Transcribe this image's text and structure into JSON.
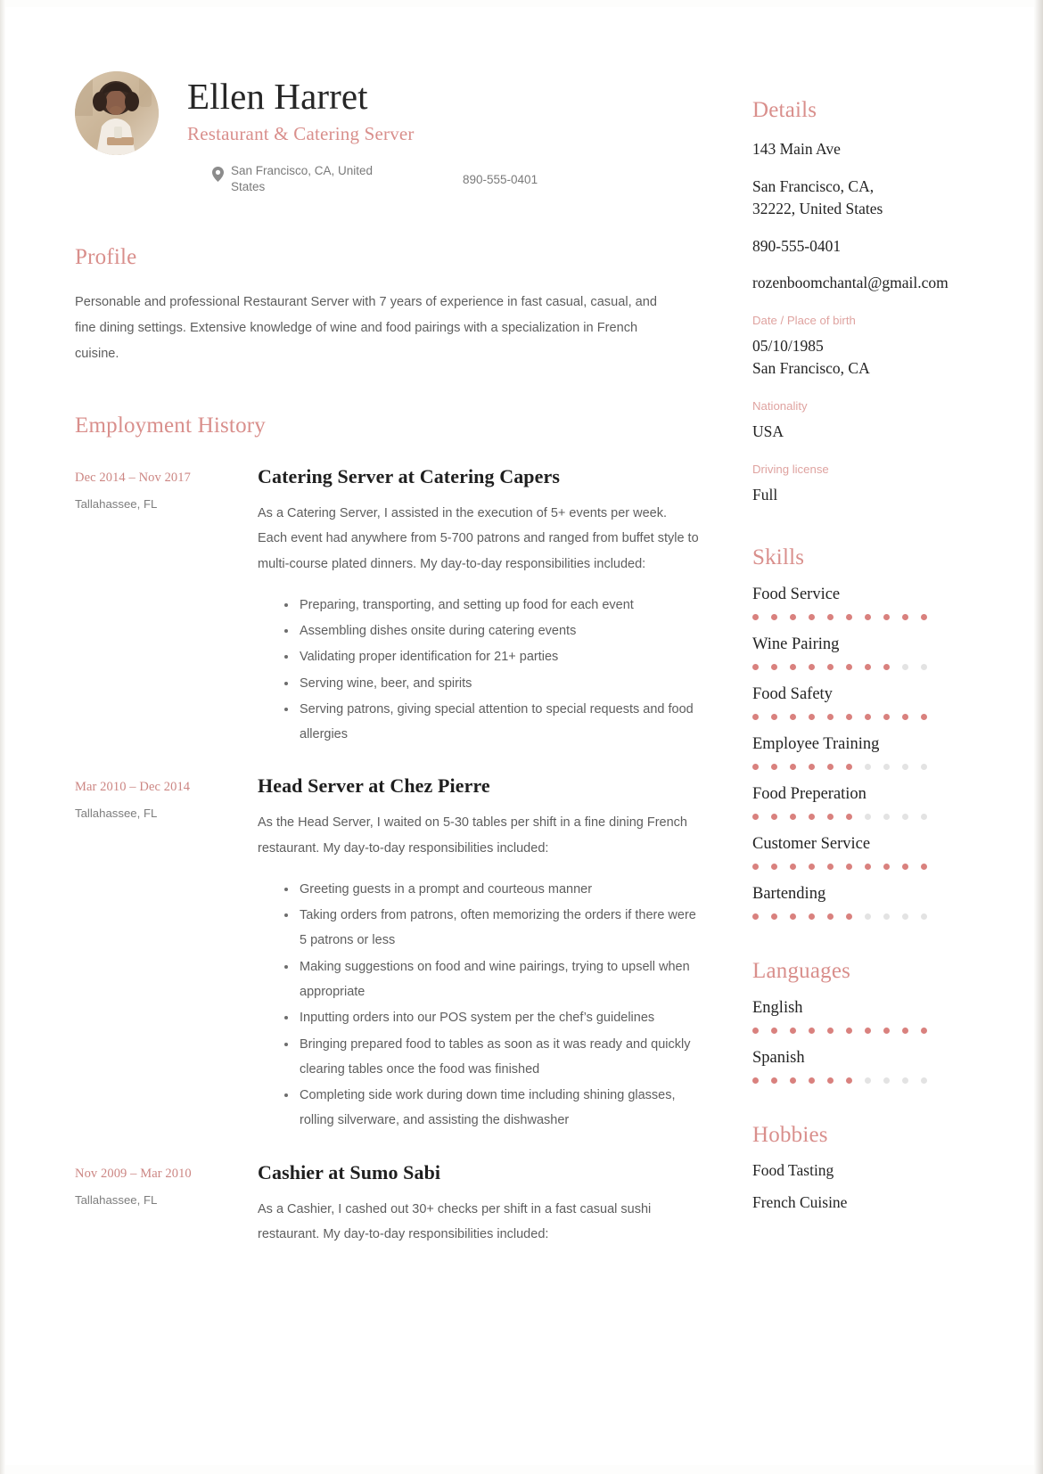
{
  "theme": {
    "accent": "#d98f8c",
    "accent_dot": "#d9817e",
    "dot_off": "#e3e3e3",
    "text": "#232323",
    "body_text": "#5e5e5e"
  },
  "header": {
    "name": "Ellen Harret",
    "job_title": "Restaurant & Catering Server",
    "location": "San Francisco, CA, United States",
    "phone": "890-555-0401"
  },
  "profile": {
    "heading": "Profile",
    "text": "Personable and professional Restaurant Server with 7 years of experience in fast casual, casual, and fine dining settings. Extensive knowledge of wine and food pairings with a specialization in French cuisine."
  },
  "employment": {
    "heading": "Employment History",
    "jobs": [
      {
        "dates": "Dec 2014 – Nov 2017",
        "location": "Tallahassee, FL",
        "title": "Catering Server at Catering Capers",
        "description": "As a Catering Server, I assisted in the execution of 5+ events per week. Each event had anywhere from 5-700 patrons and ranged from buffet style to multi-course plated dinners. My day-to-day responsibilities included:",
        "bullets": [
          "Preparing, transporting, and setting up food for each event",
          "Assembling dishes onsite during catering events",
          "Validating proper identification for 21+ parties",
          "Serving wine, beer, and spirits",
          "Serving patrons, giving special attention to special requests and food allergies"
        ]
      },
      {
        "dates": "Mar 2010 – Dec 2014",
        "location": "Tallahassee, FL",
        "title": "Head Server at Chez Pierre",
        "description": "As the Head Server, I waited on 5-30 tables per shift in a fine dining French restaurant. My day-to-day responsibilities included:",
        "bullets": [
          "Greeting guests in a prompt and courteous manner",
          "Taking orders from patrons, often memorizing the orders if there were 5 patrons or less",
          "Making suggestions on food and wine pairings, trying to upsell when appropriate",
          "Inputting orders into our POS system per the chef’s guidelines",
          "Bringing prepared food to tables as soon as it was ready and quickly clearing tables once the food was finished",
          "Completing side work during down time including shining glasses, rolling silverware, and assisting the dishwasher"
        ]
      },
      {
        "dates": "Nov 2009 – Mar 2010",
        "location": "Tallahassee, FL",
        "title": "Cashier at Sumo Sabi",
        "description": "As a Cashier, I cashed out 30+ checks per shift in a fast casual sushi restaurant. My day-to-day responsibilities included:",
        "bullets": []
      }
    ]
  },
  "details": {
    "heading": "Details",
    "address_line1": "143 Main Ave",
    "address_line2": "San Francisco, CA,\n32222, United States",
    "phone": "890-555-0401",
    "email": "rozenboomchantal@gmail.com",
    "dob_label": "Date / Place of birth",
    "dob_value": "05/10/1985\nSan Francisco, CA",
    "nationality_label": "Nationality",
    "nationality_value": "USA",
    "license_label": "Driving license",
    "license_value": "Full"
  },
  "skills": {
    "heading": "Skills",
    "max": 10,
    "items": [
      {
        "name": "Food Service",
        "level": 10
      },
      {
        "name": "Wine Pairing",
        "level": 8
      },
      {
        "name": "Food Safety",
        "level": 10
      },
      {
        "name": "Employee Training",
        "level": 6
      },
      {
        "name": "Food Preperation",
        "level": 6
      },
      {
        "name": "Customer Service",
        "level": 10
      },
      {
        "name": "Bartending",
        "level": 6
      }
    ]
  },
  "languages": {
    "heading": "Languages",
    "max": 10,
    "items": [
      {
        "name": "English",
        "level": 10
      },
      {
        "name": "Spanish",
        "level": 6
      }
    ]
  },
  "hobbies": {
    "heading": "Hobbies",
    "items": [
      "Food Tasting",
      "French Cuisine"
    ]
  }
}
